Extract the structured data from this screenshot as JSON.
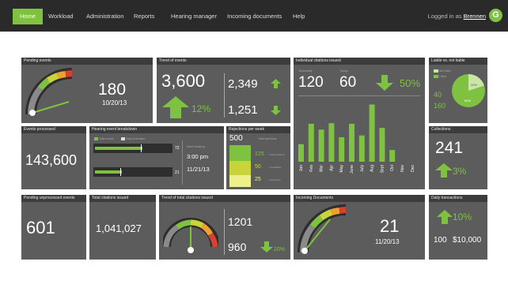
{
  "nav": {
    "items": [
      "Home",
      "Workload",
      "Administration",
      "Reports",
      "Hearing manager",
      "Incoming documents",
      "Help"
    ],
    "logged_in_label": "Logged in as",
    "user": "Brennen",
    "logo_letter": "G"
  },
  "colors": {
    "accent": "#7fc241",
    "panel": "#5c5c5c",
    "header": "#3c3c3c",
    "nav": "#2a2a2a"
  },
  "pending_events": {
    "title": "Pending events",
    "value": "180",
    "date": "10/20/13",
    "gauge_fraction": 0.6
  },
  "trend_events": {
    "title": "Trend of events",
    "value": "3,600",
    "change": "12%",
    "val_a": "2,349",
    "val_b": "1,251"
  },
  "citations": {
    "title": "Individual citations issued",
    "label_a": "Yesterday",
    "value_a": "120",
    "label_b": "Today",
    "value_b": "60",
    "change": "50%",
    "months": [
      "Jan",
      "Feb",
      "Mar",
      "Apr",
      "May",
      "June",
      "July",
      "Aug",
      "Sept",
      "Oct",
      "Nov",
      "Dec"
    ],
    "bar_values": [
      30,
      65,
      55,
      66,
      42,
      65,
      45,
      98,
      58,
      20,
      0,
      0
    ]
  },
  "liable": {
    "title": "Liable vs. not liable",
    "value_a": "40",
    "value_b": "160",
    "pct_a": "20%",
    "pct_b": "80%",
    "fraction_a": 0.2,
    "legend_a": "Not liable",
    "legend_b": "Liable"
  },
  "events_processed": {
    "title": "Events processed",
    "value": "143,600"
  },
  "hearing": {
    "title": "Hearing event breakdown",
    "legend_a": "Total events",
    "legend_b": "Total scheduled",
    "bar1_value": "72",
    "bar2_value": "21",
    "bar1_fraction": 0.62,
    "bar2_fraction": 0.35,
    "label": "Next hearing",
    "time": "3:00 pm",
    "date": "11/21/13"
  },
  "rejections": {
    "title": "Rejections per week",
    "max": "500",
    "max_label": "Total rejections",
    "levels": [
      "125",
      "50",
      "25"
    ],
    "level_labels": [
      "Invalid address",
      "Unreadable",
      "Incomplete"
    ]
  },
  "collections": {
    "title": "Collections",
    "value": "241",
    "change": "3%"
  },
  "pending_unprocessed": {
    "title": "Pending unprocessed events",
    "value": "601"
  },
  "total_citations": {
    "title": "Total citations issued",
    "value": "1,041,027"
  },
  "trend_total": {
    "title": "Trend of total citations issued",
    "value_a": "1201",
    "value_b": "960",
    "change": "20%",
    "gauge_fraction": 0.45
  },
  "incoming": {
    "title": "Incoming Documents",
    "value": "21",
    "date": "11/20/13",
    "gauge_fraction": 0.58
  },
  "daily": {
    "title": "Daily transactions",
    "change": "10%",
    "value_a": "100",
    "value_b": "$10,000"
  }
}
